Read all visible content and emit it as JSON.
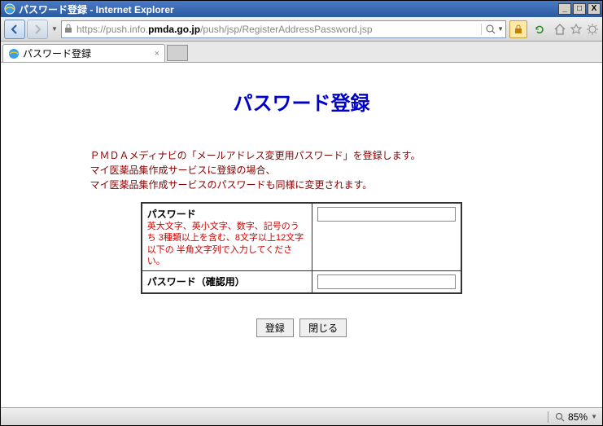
{
  "window": {
    "title": "パスワード登録 - Internet Explorer"
  },
  "address": {
    "scheme": "https://",
    "host_pre": "push.info.",
    "host_bold": "pmda.go.jp",
    "path": "/push/jsp/RegisterAddressPassword.jsp"
  },
  "tab": {
    "title": "パスワード登録"
  },
  "page": {
    "heading": "パスワード登録",
    "desc_line1": "ＰＭＤＡメディナビの「メールアドレス変更用パスワード」を登録します。",
    "desc_line2": "マイ医薬品集作成サービスに登録の場合、",
    "desc_line3": "マイ医薬品集作成サービスのパスワードも同様に変更されます。"
  },
  "form": {
    "pw_label": "パスワード",
    "pw_hint": "英大文字、英小文字、数字、記号のうち\n3種類以上を含む、8文字以上12文字以下の\n半角文字列で入力してください。",
    "pw_confirm_label": "パスワード（確認用）",
    "pw_value": "",
    "pw_confirm_value": "",
    "btn_register": "登録",
    "btn_close": "閉じる"
  },
  "status": {
    "zoom": "85%"
  },
  "icons": {
    "back": "back-arrow",
    "forward": "forward-arrow",
    "search": "magnifier-icon",
    "lock": "lock-icon",
    "refresh": "refresh-icon",
    "home": "home-icon",
    "star": "favorites-icon",
    "gear": "tools-icon",
    "ie": "ie-logo"
  }
}
